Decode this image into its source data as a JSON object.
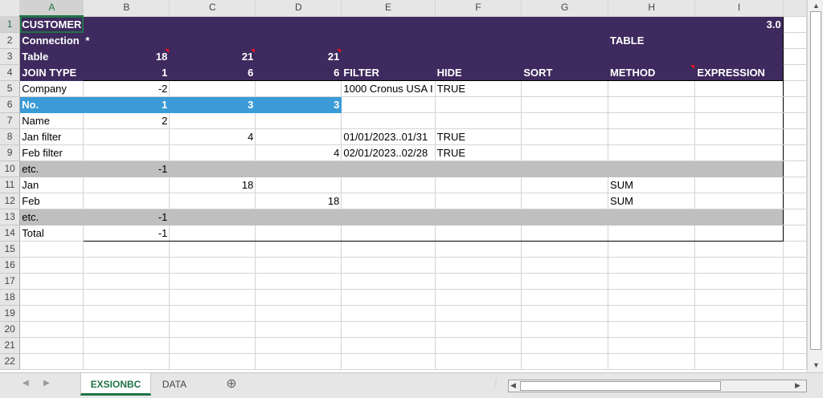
{
  "columns": [
    "A",
    "B",
    "C",
    "D",
    "E",
    "F",
    "G",
    "H",
    "I"
  ],
  "rows": [
    {
      "n": "1",
      "cells": [
        "CUSTOMER",
        "",
        "",
        "",
        "",
        "",
        "",
        "",
        "3.0"
      ]
    },
    {
      "n": "2",
      "cells": [
        "Connection",
        "*",
        "",
        "",
        "",
        "",
        "",
        "TABLE",
        ""
      ]
    },
    {
      "n": "3",
      "cells": [
        "Table",
        "18",
        "21",
        "21",
        "",
        "",
        "",
        "",
        ""
      ]
    },
    {
      "n": "4",
      "cells": [
        "JOIN TYPE",
        "1",
        "6",
        "6",
        "FILTER",
        "HIDE",
        "SORT",
        "METHOD",
        "EXPRESSION"
      ]
    },
    {
      "n": "5",
      "cells": [
        "Company",
        "-2",
        "",
        "",
        "1000 Cronus USA I",
        "TRUE",
        "",
        "",
        ""
      ]
    },
    {
      "n": "6",
      "cells": [
        "No.",
        "1",
        "3",
        "3",
        "",
        "",
        "",
        "",
        ""
      ]
    },
    {
      "n": "7",
      "cells": [
        "Name",
        "2",
        "",
        "",
        "",
        "",
        "",
        "",
        ""
      ]
    },
    {
      "n": "8",
      "cells": [
        "Jan filter",
        "",
        "4",
        "",
        "01/01/2023..01/31",
        "TRUE",
        "",
        "",
        ""
      ]
    },
    {
      "n": "9",
      "cells": [
        "Feb filter",
        "",
        "",
        "4",
        "02/01/2023..02/28",
        "TRUE",
        "",
        "",
        ""
      ]
    },
    {
      "n": "10",
      "cells": [
        "etc.",
        "-1",
        "",
        "",
        "",
        "",
        "",
        "",
        ""
      ]
    },
    {
      "n": "11",
      "cells": [
        "Jan",
        "",
        "18",
        "",
        "",
        "",
        "",
        "SUM",
        ""
      ]
    },
    {
      "n": "12",
      "cells": [
        "Feb",
        "",
        "",
        "18",
        "",
        "",
        "",
        "SUM",
        ""
      ]
    },
    {
      "n": "13",
      "cells": [
        "etc.",
        "-1",
        "",
        "",
        "",
        "",
        "",
        "",
        ""
      ]
    },
    {
      "n": "14",
      "cells": [
        "Total",
        "-1",
        "",
        "",
        "",
        "",
        "",
        "",
        ""
      ]
    },
    {
      "n": "15",
      "cells": [
        "",
        "",
        "",
        "",
        "",
        "",
        "",
        "",
        ""
      ]
    },
    {
      "n": "16",
      "cells": [
        "",
        "",
        "",
        "",
        "",
        "",
        "",
        "",
        ""
      ]
    },
    {
      "n": "17",
      "cells": [
        "",
        "",
        "",
        "",
        "",
        "",
        "",
        "",
        ""
      ]
    },
    {
      "n": "18",
      "cells": [
        "",
        "",
        "",
        "",
        "",
        "",
        "",
        "",
        ""
      ]
    },
    {
      "n": "19",
      "cells": [
        "",
        "",
        "",
        "",
        "",
        "",
        "",
        "",
        ""
      ]
    },
    {
      "n": "20",
      "cells": [
        "",
        "",
        "",
        "",
        "",
        "",
        "",
        "",
        ""
      ]
    },
    {
      "n": "21",
      "cells": [
        "",
        "",
        "",
        "",
        "",
        "",
        "",
        "",
        ""
      ]
    },
    {
      "n": "22",
      "cells": [
        "",
        "",
        "",
        "",
        "",
        "",
        "",
        "",
        ""
      ]
    }
  ],
  "tabs": {
    "sheet1": "EXSIONBC",
    "sheet2": "DATA",
    "add": "⊕"
  },
  "colors": {
    "purple": "#3e2a5e",
    "blue": "#3a9bd7",
    "gray": "#bfbfbf",
    "accent": "#217346"
  }
}
